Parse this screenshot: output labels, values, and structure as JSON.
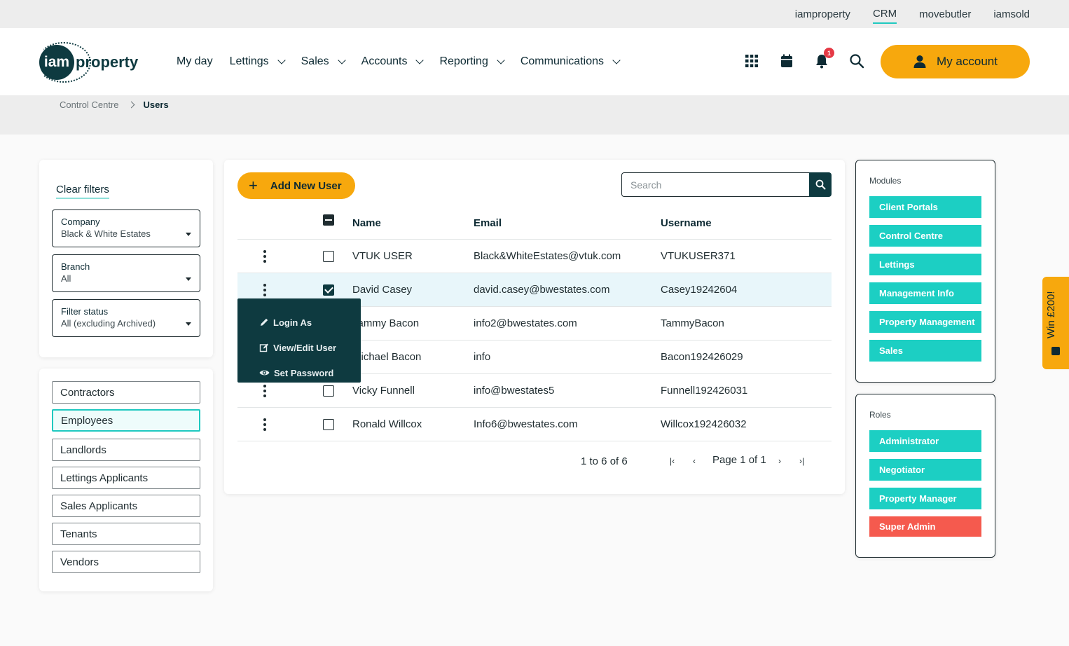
{
  "topbar": {
    "links": [
      "iamproperty",
      "CRM",
      "movebutler",
      "iamsold"
    ],
    "active": "CRM"
  },
  "header": {
    "logo_badge": "iam",
    "logo_word": "property",
    "nav": [
      {
        "label": "My day",
        "dropdown": false
      },
      {
        "label": "Lettings",
        "dropdown": true
      },
      {
        "label": "Sales",
        "dropdown": true
      },
      {
        "label": "Accounts",
        "dropdown": true
      },
      {
        "label": "Reporting",
        "dropdown": true
      },
      {
        "label": "Communications",
        "dropdown": true
      }
    ],
    "notification_count": "1",
    "account_label": "My account",
    "icons": [
      "apps-grid-icon",
      "calendar-icon",
      "bell-icon",
      "search-icon",
      "user-icon"
    ]
  },
  "breadcrumb": {
    "parent": "Control Centre",
    "current": "Users"
  },
  "filters": {
    "clear_label": "Clear filters",
    "company": {
      "label": "Company",
      "value": "Black & White Estates"
    },
    "branch": {
      "label": "Branch",
      "value": "All"
    },
    "status": {
      "label": "Filter status",
      "value": "All (excluding Archived)"
    }
  },
  "user_types": {
    "items": [
      "Contractors",
      "Employees",
      "Landlords",
      "Lettings Applicants",
      "Sales Applicants",
      "Tenants",
      "Vendors"
    ],
    "selected": "Employees"
  },
  "toolbar": {
    "add_label": "Add New User",
    "search_placeholder": "Search"
  },
  "table": {
    "columns": [
      "Name",
      "Email",
      "Username"
    ],
    "rows": [
      {
        "name": "VTUK USER",
        "email": "Black&WhiteEstates@vtuk.com",
        "username": "VTUKUSER371",
        "checked": false
      },
      {
        "name": "David Casey",
        "email": "david.casey@bwestates.com",
        "username": "Casey19242604",
        "checked": true
      },
      {
        "name": "Tammy Bacon",
        "email": "info2@bwestates.com",
        "username": "TammyBacon",
        "checked": false
      },
      {
        "name": "Michael Bacon",
        "email": "info",
        "username": "Bacon192426029",
        "checked": false
      },
      {
        "name": "Vicky Funnell",
        "email": "info@bwestates5",
        "username": "Funnell192426031",
        "checked": false
      },
      {
        "name": "Ronald Willcox",
        "email": "Info6@bwestates.com",
        "username": "Willcox192426032",
        "checked": false
      }
    ]
  },
  "pager": {
    "count": "1 to 6 of 6",
    "page": "Page 1 of 1",
    "first": "|‹",
    "prev": "‹",
    "next": "›",
    "last": "›|"
  },
  "row_menu": {
    "items": [
      "Login As",
      "View/Edit User",
      "Set Password"
    ]
  },
  "modules": {
    "title": "Modules",
    "items": [
      "Client Portals",
      "Control Centre",
      "Lettings",
      "Management Info",
      "Property Management",
      "Sales"
    ]
  },
  "roles": {
    "title": "Roles",
    "items": [
      "Administrator",
      "Negotiator",
      "Property Manager",
      "Super Admin"
    ]
  },
  "promo": {
    "label": "Win £200!"
  },
  "colors": {
    "accent": "#f7a80d",
    "teal": "#1ccfc3",
    "dark": "#0e3a40",
    "danger": "#f55a4e"
  }
}
